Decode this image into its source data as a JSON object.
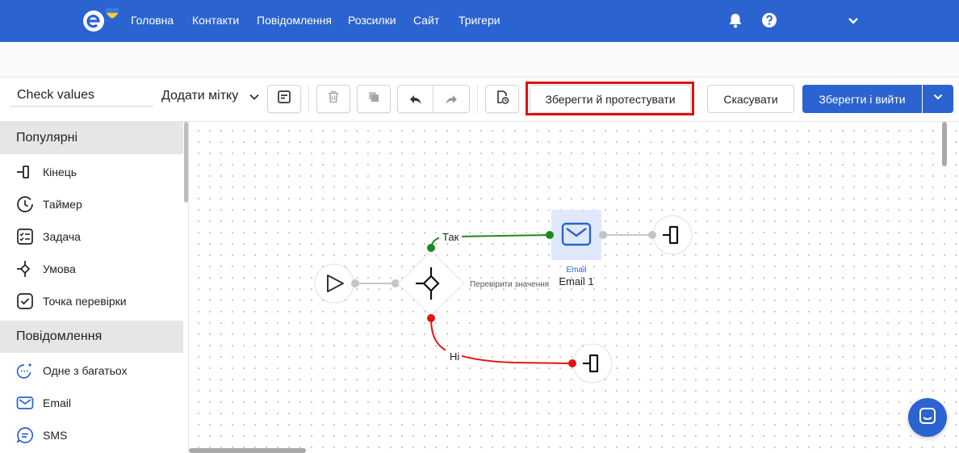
{
  "nav": {
    "items": [
      "Головна",
      "Контакти",
      "Повідомлення",
      "Розсилки",
      "Сайт",
      "Тригери"
    ],
    "brand_color": "#2b63d0",
    "icons": [
      "bell-icon",
      "help-icon",
      "chevron-down-icon"
    ]
  },
  "toolbar": {
    "name_value": "Check values",
    "add_tag": "Додати мітку",
    "save_test": "Зберегти й протестувати",
    "cancel": "Скасувати",
    "save_exit": "Зберегти і вийти",
    "highlight_color": "#e01010"
  },
  "sidebar": {
    "sections": [
      {
        "title": "Популярні",
        "items": [
          {
            "label": "Кінець",
            "icon": "end-icon"
          },
          {
            "label": "Таймер",
            "icon": "timer-icon"
          },
          {
            "label": "Задача",
            "icon": "task-icon"
          },
          {
            "label": "Умова",
            "icon": "condition-icon"
          },
          {
            "label": "Точка перевірки",
            "icon": "checkpoint-icon"
          }
        ]
      },
      {
        "title": "Повідомлення",
        "items": [
          {
            "label": "Одне з багатьох",
            "icon": "one-of-many-icon"
          },
          {
            "label": "Email",
            "icon": "email-icon"
          },
          {
            "label": "SMS",
            "icon": "sms-icon"
          }
        ]
      }
    ]
  },
  "flow": {
    "condition_label": "Перевірити значення",
    "yes_label": "Так",
    "no_label": "Ні",
    "email_type": "Email",
    "email_name": "Email 1",
    "yes_color": "#1e8a1e",
    "no_color": "#e31313"
  }
}
